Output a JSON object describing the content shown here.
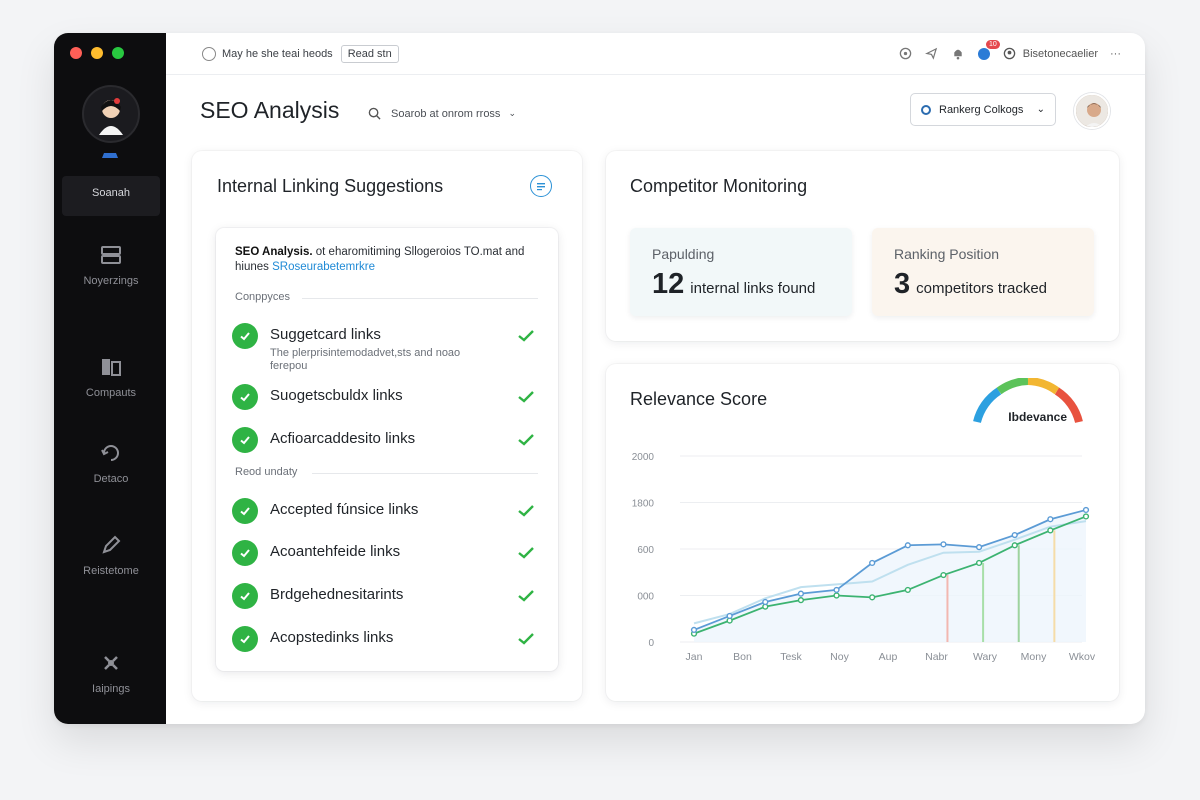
{
  "window": {
    "topbar": {
      "breadcrumb": "May he she teai heods",
      "pill": "Read stn",
      "notification_count": "10",
      "account": "Bisetonecaelier",
      "more": "···"
    },
    "sidebar": {
      "items": [
        {
          "label": "Soanah",
          "icon": "search-icon",
          "active": true
        },
        {
          "label": "Noyerzings",
          "icon": "server-icon"
        },
        {
          "label": "Compauts",
          "icon": "compare-icon"
        },
        {
          "label": "Detaco",
          "icon": "refresh-icon"
        },
        {
          "label": "Reistetome",
          "icon": "edit-icon"
        },
        {
          "label": "Iaipings",
          "icon": "settings-icon"
        }
      ]
    },
    "page_title": "SEO Analysis",
    "search": {
      "placeholder": "Soarob at onrom rross"
    },
    "ranking_select": {
      "value": "Rankerg Colkogs"
    },
    "internal_linking": {
      "title": "Internal Linking Suggestions",
      "intro_bold": "SEO Analysis.",
      "intro_text": "ot eharomitiming  Sllogeroios TO.mat and hiunes",
      "intro_link": "SRoseurabetemrkre",
      "section1_label": "Conppyces",
      "section2_label": "Reod undaty",
      "rows": [
        {
          "label": "Suggetcard links",
          "sub": "The plerprisintemodadvet,sts and noao ferepou"
        },
        {
          "label": "Suogetscbuldx links"
        },
        {
          "label": "Acfioarcaddesito links"
        },
        {
          "label": "Accepted fúnsice links"
        },
        {
          "label": "Acoantehfeide links"
        },
        {
          "label": "Brdgehednesitarints"
        },
        {
          "label": "Acopstedinks links"
        }
      ]
    },
    "competitor": {
      "title": "Competitor Monitoring",
      "stats": [
        {
          "caption": "Papulding",
          "value": "12",
          "desc": "internal links found"
        },
        {
          "caption": "Ranking Position",
          "value": "3",
          "desc": "competitors tracked"
        }
      ]
    },
    "relevance": {
      "title": "Relevance Score",
      "gauge_label": "Ibdevance"
    }
  },
  "colors": {
    "accent_green": "#2fb344",
    "line_blue": "#5b9bd5",
    "line_green": "#3cb371",
    "sidebar_bg": "#0d0d0f"
  },
  "chart_data": {
    "type": "line",
    "title": "Relevance Score",
    "categories": [
      "Jan",
      "Bon",
      "Tesk",
      "Noy",
      "Aup",
      "Nabr",
      "Wary",
      "Mony",
      "Wkov"
    ],
    "yticks": [
      "2000",
      "1800",
      "600",
      "000",
      "0"
    ],
    "ylim": [
      0,
      2000
    ],
    "series": [
      {
        "values": [
          130,
          280,
          430,
          520,
          560,
          850,
          1040,
          1050,
          1020,
          1150,
          1320,
          1420
        ]
      },
      {
        "values": [
          90,
          230,
          380,
          450,
          500,
          480,
          560,
          720,
          850,
          1040,
          1200,
          1350
        ]
      },
      {
        "values": [
          200,
          300,
          470,
          590,
          620,
          650,
          830,
          960,
          970,
          1100,
          1240,
          1300
        ]
      }
    ]
  }
}
